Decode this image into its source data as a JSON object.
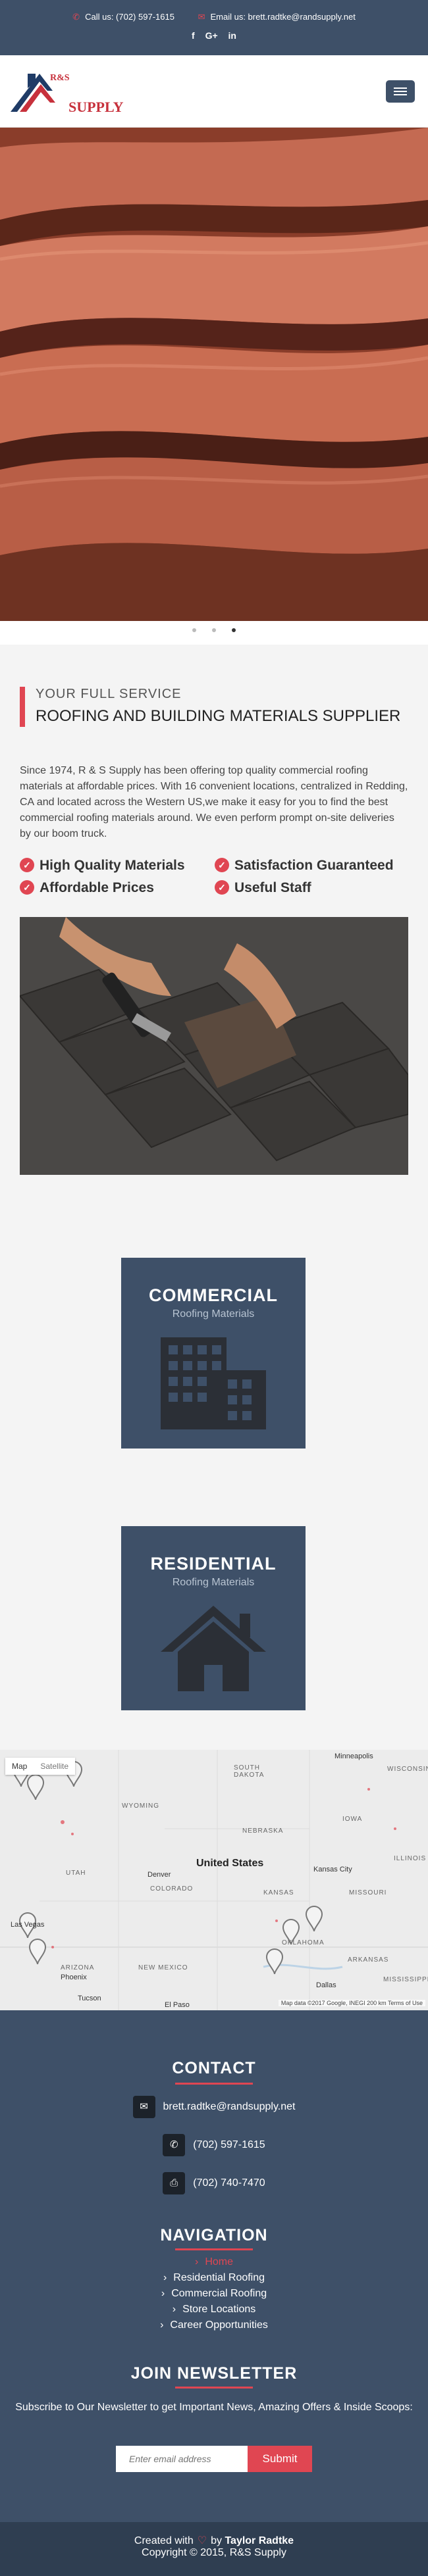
{
  "topbar": {
    "phone_label": "Call us: (702) 597-1615",
    "email_label": "Email us: brett.radtke@randsupply.net",
    "social": [
      "f",
      "G+",
      "in"
    ]
  },
  "header": {
    "logo_letters": "R&S",
    "logo_text": "SUPPLY"
  },
  "intro": {
    "kicker": "YOUR FULL SERVICE",
    "title": "ROOFING AND BUILDING MATERIALS SUPPLIER",
    "text": "Since 1974, R & S Supply has been offering top quality commercial roofing materials at affordable prices. With 16 convenient locations, centralized in Redding, CA and located across the Western US,we make it easy for you to find the best commercial roofing materials around. We even perform prompt on-site deliveries by our boom truck.",
    "features": [
      "High Quality Materials",
      "Satisfaction Guaranteed",
      "Affordable Prices",
      "Useful Staff"
    ]
  },
  "categories": [
    {
      "title": "COMMERCIAL",
      "subtitle": "Roofing Materials"
    },
    {
      "title": "RESIDENTIAL",
      "subtitle": "Roofing Materials"
    }
  ],
  "map": {
    "type_map": "Map",
    "type_satellite": "Satellite",
    "country": "United States",
    "states": [
      "SOUTH DAKOTA",
      "WYOMING",
      "NEBRASKA",
      "IOWA",
      "UTAH",
      "COLORADO",
      "KANSAS",
      "MISSOURI",
      "ILLINOIS",
      "ARIZONA",
      "NEW MEXICO",
      "OKLAHOMA",
      "ARKANSAS",
      "MISSISSIPPI",
      "WISCONSIN"
    ],
    "cities": [
      "Minneapolis",
      "Denver",
      "Kansas City",
      "Las Vegas",
      "Phoenix",
      "Tucson",
      "El Paso",
      "Dallas"
    ],
    "footer": "Map data ©2017 Google, INEGI   200 km   Terms of Use"
  },
  "footer": {
    "contact_heading": "CONTACT",
    "email": "brett.radtke@randsupply.net",
    "phone": "(702) 597-1615",
    "fax": "(702) 740-7470",
    "nav_heading": "NAVIGATION",
    "nav_links": [
      "Home",
      "Residential Roofing",
      "Commercial Roofing",
      "Store Locations",
      "Career Opportunities"
    ],
    "newsletter_heading": "JOIN NEWSLETTER",
    "newsletter_text": "Subscribe to Our Newsletter to get Important News, Amazing Offers & Inside Scoops:",
    "email_placeholder": "Enter email address",
    "submit_label": "Submit"
  },
  "copyright": {
    "created_with": "Created with",
    "by": "by",
    "author": "Taylor Radtke",
    "copyright": "Copyright © 2015, R&S Supply"
  },
  "colors": {
    "primary": "#3e5068",
    "accent": "#e04652",
    "dark": "#2f3e51"
  }
}
